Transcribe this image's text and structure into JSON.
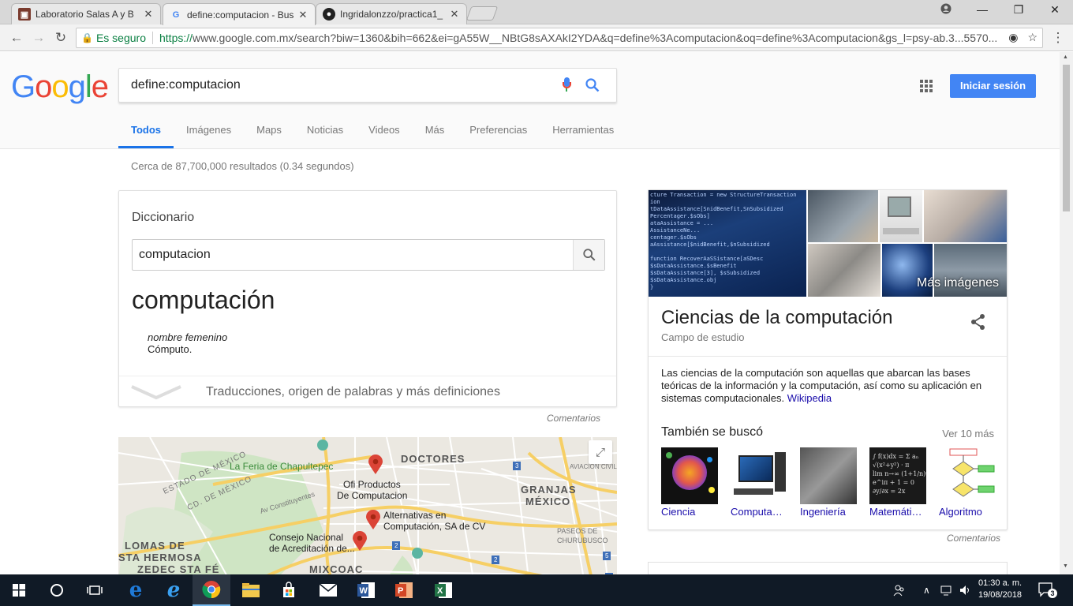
{
  "browser": {
    "tabs": [
      {
        "title": "Laboratorio Salas A y B",
        "icon": "lab-favicon"
      },
      {
        "title": "define:computacion - Bus",
        "icon": "google-favicon"
      },
      {
        "title": "Ingridalonzzo/practica1_",
        "icon": "github-favicon"
      }
    ],
    "secure_label": "Es seguro",
    "url_protocol": "https://",
    "url_rest": "www.google.com.mx/search?biw=1360&bih=662&ei=gA55W__NBtG8sAXAkI2YDA&q=define%3Acomputacion&oq=define%3Acomputacion&gs_l=psy-ab.3...5570..."
  },
  "google": {
    "logo": [
      "G",
      "o",
      "o",
      "g",
      "l",
      "e"
    ],
    "logo_colors": [
      "#4285f4",
      "#ea4335",
      "#fbbc05",
      "#4285f4",
      "#34a853",
      "#ea4335"
    ],
    "query": "define:computacion",
    "signin_label": "Iniciar sesión",
    "tabs": [
      "Todos",
      "Imágenes",
      "Maps",
      "Noticias",
      "Videos",
      "Más",
      "Preferencias",
      "Herramientas"
    ],
    "active_tab": "Todos",
    "result_stats": "Cerca de 87,700,000 resultados (0.34 segundos)"
  },
  "dictionary": {
    "label": "Diccionario",
    "input_value": "computacion",
    "word": "computación",
    "part_of_speech": "nombre femenino",
    "definition": "Cómputo.",
    "more_link": "Traducciones, origen de palabras y más definiciones",
    "feedback": "Comentarios"
  },
  "map": {
    "labels": {
      "doctores": "DOCTORES",
      "feria": "La Feria de Chapultepec",
      "estado_mexico": "ESTADO DE MÉXICO",
      "cd_mexico": "CD. DE MÉXICO",
      "av_constituyentes": "Av Constituyentes",
      "ofi_productos": "Ofi Productos",
      "de_computacion": "De Computacion",
      "granjas": "GRANJAS",
      "mexico": "MÉXICO",
      "aviacion": "AVIACIÓN CIVIL",
      "alternativas_1": "Alternativas en",
      "alternativas_2": "Computación, SA de CV",
      "paseos_1": "PASEOS DE",
      "paseos_2": "CHURUBUSCO",
      "consejo_1": "Consejo Nacional",
      "consejo_2": "de Acreditación de...",
      "lomas_1": "LOMAS DE",
      "lomas_2": "STA HERMOSA",
      "zedec": "ZEDEC STA FÉ",
      "mixcoac": "MIXCOAC"
    },
    "route_numbers": [
      "3",
      "2",
      "2",
      "5",
      "3"
    ]
  },
  "knowledge_panel": {
    "more_images": "Más imágenes",
    "title": "Ciencias de la computación",
    "subtitle": "Campo de estudio",
    "description": "Las ciencias de la computación son aquellas que abarcan las bases teóricas de la información y la computación, así como su aplicación en sistemas computacionales.",
    "source": "Wikipedia",
    "related_title": "También se buscó",
    "related_more": "Ver 10 más",
    "related": [
      "Ciencia",
      "Computa…",
      "Ingeniería",
      "Matemáti…",
      "Algoritmo"
    ],
    "feedback": "Comentarios"
  },
  "taskbar": {
    "time": "01:30 a. m.",
    "date": "19/08/2018",
    "notification_count": "3"
  },
  "colors": {
    "google_blue": "#4285f4",
    "link": "#1a0dab",
    "taskbar": "#101a26"
  }
}
